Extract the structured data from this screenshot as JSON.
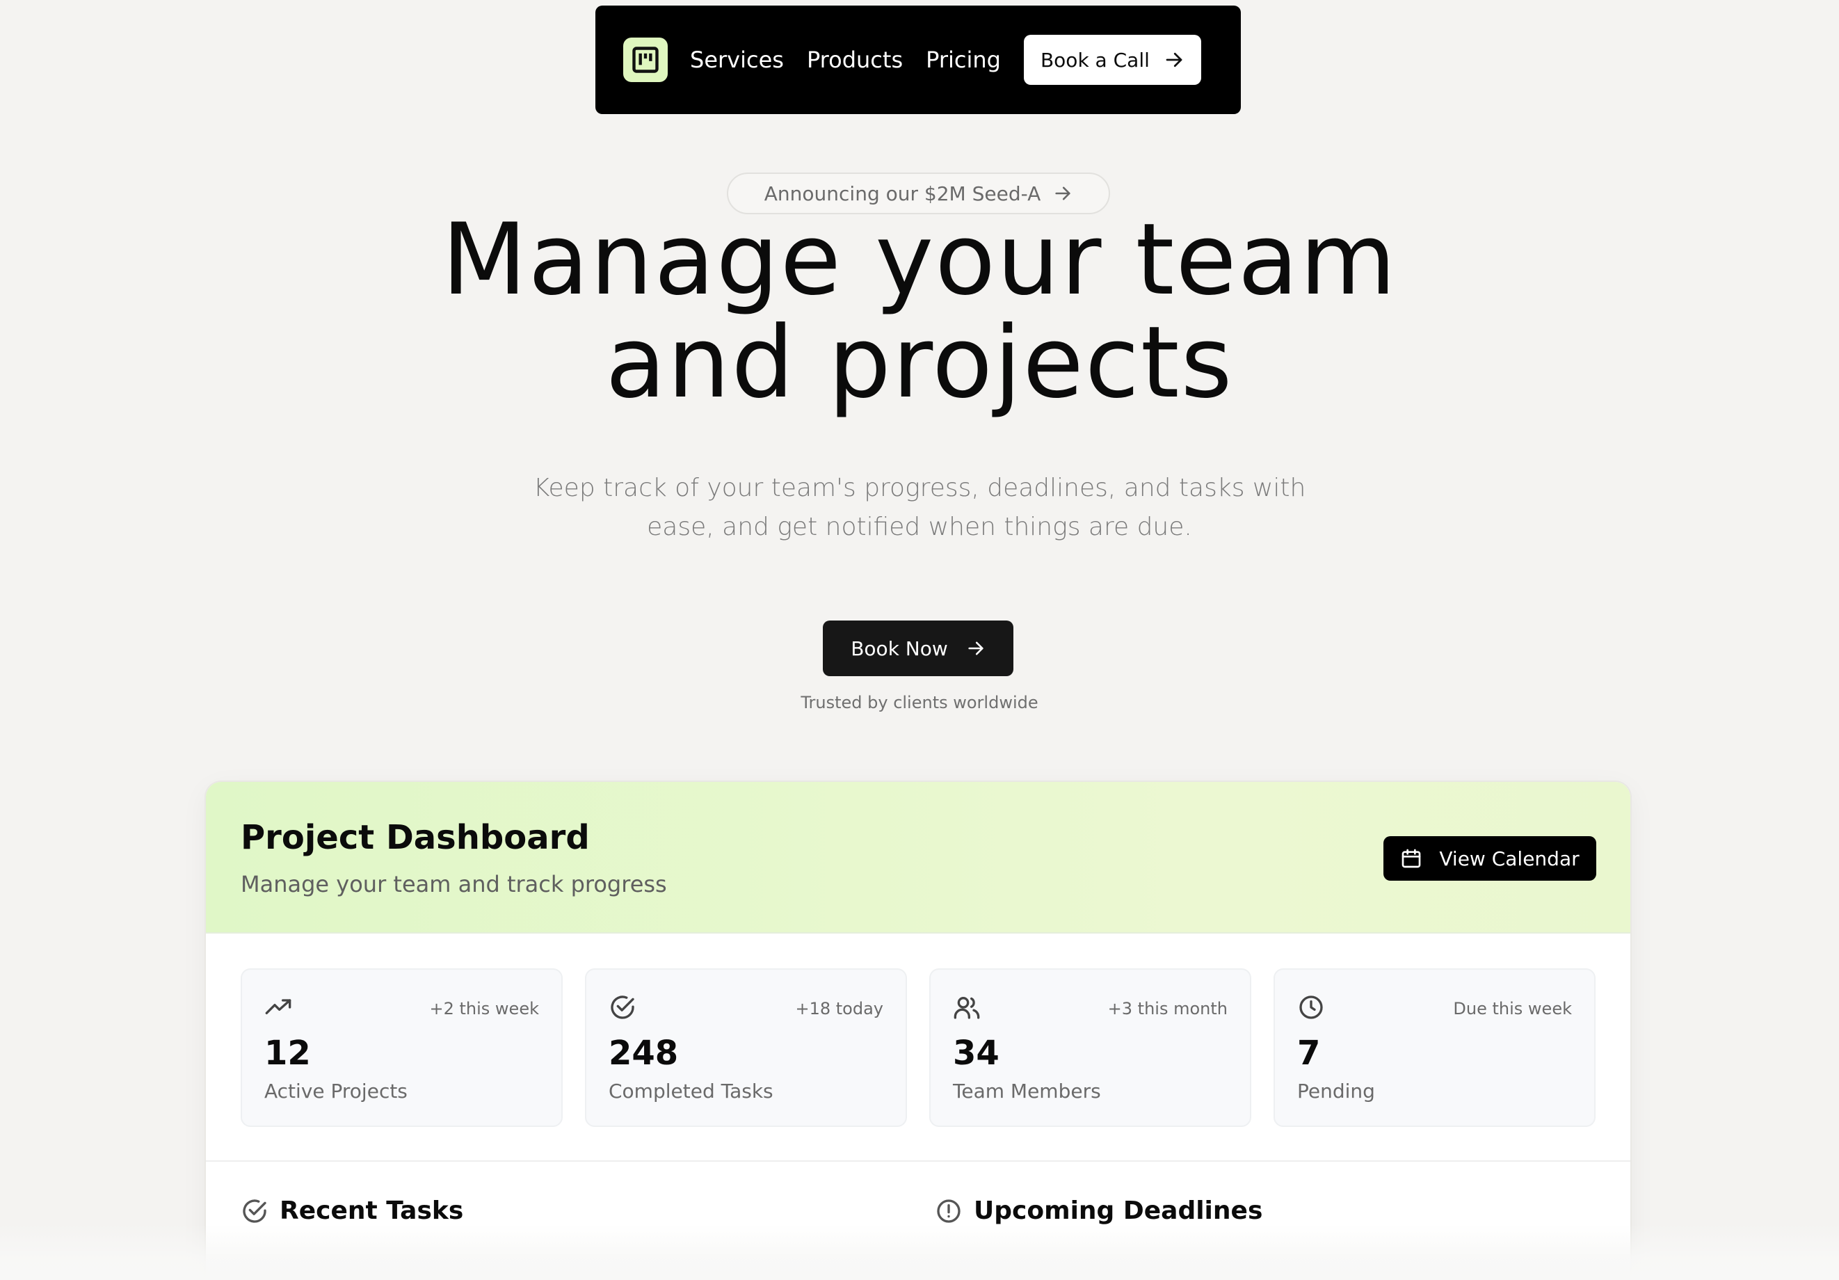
{
  "nav": {
    "links": [
      "Services",
      "Products",
      "Pricing"
    ],
    "cta_label": "Book a Call",
    "icons": {
      "logo": "kanban-board-icon",
      "cta": "arrow-right-icon"
    }
  },
  "announcement": {
    "label": "Announcing our $2M Seed-A",
    "icon": "arrow-right-icon"
  },
  "hero": {
    "title_line1": "Manage your team",
    "title_line2": "and projects",
    "subtitle_line1": "Keep track of your team's progress, deadlines, and tasks with",
    "subtitle_line2": "ease, and get notified when things are due.",
    "button_label": "Book Now",
    "trusted": "Trusted by clients worldwide"
  },
  "dashboard": {
    "title": "Project Dashboard",
    "subtitle": "Manage your team and track progress",
    "calendar_button": "View Calendar",
    "stats": [
      {
        "icon": "trending-up-icon",
        "note": "+2 this week",
        "value": "12",
        "label": "Active Projects"
      },
      {
        "icon": "check-circle-icon",
        "note": "+18 today",
        "value": "248",
        "label": "Completed Tasks"
      },
      {
        "icon": "users-icon",
        "note": "+3 this month",
        "value": "34",
        "label": "Team Members"
      },
      {
        "icon": "clock-icon",
        "note": "Due this week",
        "value": "7",
        "label": "Pending"
      }
    ],
    "sections": {
      "recent_tasks": "Recent Tasks",
      "upcoming_deadlines": "Upcoming Deadlines"
    }
  },
  "colors": {
    "background": "#f4f3f1",
    "nav_bg": "#000000",
    "accent_lime": "#dff6bf",
    "button_dark": "#171717",
    "text_muted": "#6a6a6a"
  }
}
